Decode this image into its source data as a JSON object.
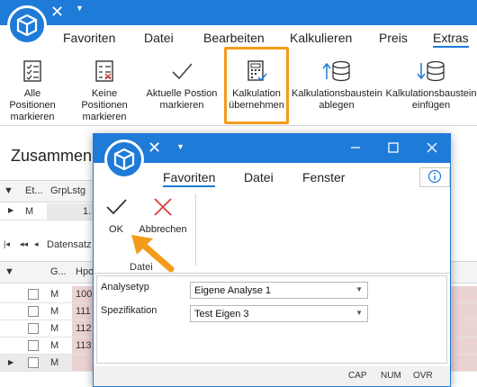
{
  "app": {
    "tabs": [
      "Favoriten",
      "Datei",
      "Bearbeiten",
      "Kalkulieren",
      "Preis",
      "Extras"
    ],
    "active_tab": "Extras"
  },
  "ribbon": {
    "buttons": [
      {
        "l1": "Alle Positionen",
        "l2": "markieren",
        "icon": "checklist-icon"
      },
      {
        "l1": "Keine Positionen",
        "l2": "markieren",
        "icon": "checklist-none-icon"
      },
      {
        "l1": "Aktuelle Postion",
        "l2": "markieren",
        "icon": "checkmark-icon"
      },
      {
        "l1": "Kalkulation",
        "l2": "übernehmen",
        "icon": "calculator-icon"
      },
      {
        "l1": "Kalkulationsbaustein",
        "l2": "ablegen",
        "icon": "database-up-icon"
      },
      {
        "l1": "Kalkulationsbaustein",
        "l2": "einfügen",
        "icon": "database-down-icon"
      }
    ]
  },
  "main": {
    "title_partial": "Zusammen",
    "top_grid": {
      "headers": [
        "Et...",
        "GrpLstg"
      ],
      "row": {
        "col1": "M",
        "col2": "1."
      },
      "nav_text": "Datensatz"
    },
    "bottom_grid": {
      "headers": [
        "G...",
        "Hpos"
      ],
      "rows": [
        {
          "g": "M",
          "h": "100"
        },
        {
          "g": "M",
          "h": "111"
        },
        {
          "g": "M",
          "h": "112"
        },
        {
          "g": "M",
          "h": "113"
        },
        {
          "g": "M",
          "h": ""
        }
      ]
    }
  },
  "dialog": {
    "tabs": [
      "Favoriten",
      "Datei",
      "Fenster"
    ],
    "active_tab": "Favoriten",
    "ok_label": "OK",
    "cancel_label": "Abbrechen",
    "group_label": "Datei",
    "fields": [
      {
        "label": "Analysetyp",
        "value": "Eigene Analyse 1"
      },
      {
        "label": "Spezifikation",
        "value": "Test Eigen 3"
      }
    ],
    "status": {
      "cap": "CAP",
      "num": "NUM",
      "ovr": "OVR"
    }
  },
  "colors": {
    "accent": "#1e7bd7",
    "highlight": "#f39c1b",
    "cancel_red": "#e03b3b"
  }
}
